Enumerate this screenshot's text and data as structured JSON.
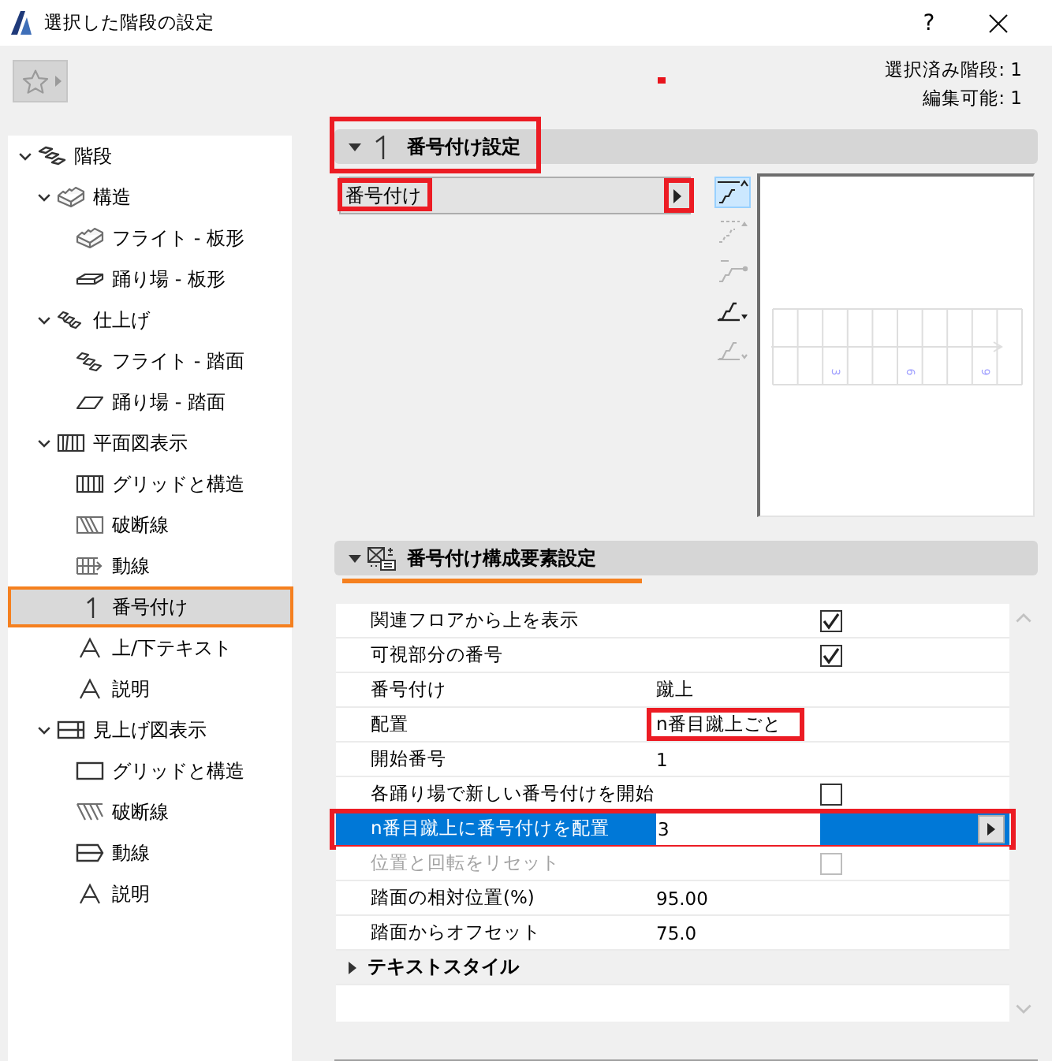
{
  "window": {
    "title": "選択した階段の設定",
    "help": "?"
  },
  "toolbar": {
    "selection_info": [
      "選択済み階段: 1",
      "編集可能: 1"
    ]
  },
  "tree": [
    {
      "label": "階段",
      "kind": "stair",
      "expanded": true,
      "selected": false,
      "children": [
        {
          "label": "構造",
          "kind": "structure",
          "expanded": true,
          "selected": false,
          "children": [
            {
              "label": "フライト - 板形",
              "kind": "flight-slab",
              "selected": false
            },
            {
              "label": "踊り場 - 板形",
              "kind": "landing-slab",
              "selected": false
            }
          ]
        },
        {
          "label": "仕上げ",
          "kind": "finish",
          "expanded": true,
          "selected": false,
          "children": [
            {
              "label": "フライト - 踏面",
              "kind": "flight-tread",
              "selected": false
            },
            {
              "label": "踊り場 - 踏面",
              "kind": "landing-tread",
              "selected": false
            }
          ]
        },
        {
          "label": "平面図表示",
          "kind": "plan",
          "expanded": true,
          "selected": false,
          "children": [
            {
              "label": "グリッドと構造",
              "kind": "grid",
              "selected": false
            },
            {
              "label": "破断線",
              "kind": "break-line",
              "selected": false
            },
            {
              "label": "動線",
              "kind": "walk-line",
              "selected": false
            },
            {
              "label": "番号付け",
              "kind": "numbering",
              "selected": true
            },
            {
              "label": "上/下テキスト",
              "kind": "text",
              "selected": false
            },
            {
              "label": "説明",
              "kind": "text",
              "selected": false
            }
          ]
        },
        {
          "label": "見上げ図表示",
          "kind": "ceiling",
          "expanded": true,
          "selected": false,
          "children": [
            {
              "label": "グリッドと構造",
              "kind": "outline",
              "selected": false
            },
            {
              "label": "破断線",
              "kind": "hatch",
              "selected": false
            },
            {
              "label": "動線",
              "kind": "box-arrow",
              "selected": false
            },
            {
              "label": "説明",
              "kind": "text",
              "selected": false
            }
          ]
        }
      ]
    }
  ],
  "numbering_settings": {
    "title": "番号付け設定",
    "expanded": true,
    "highlighted": true,
    "dropdown": {
      "label": "番号付け",
      "label_highlighted": true,
      "arrow_highlighted": true
    },
    "style_buttons": [
      {
        "kind": "top-line",
        "selected": true,
        "disabled": false
      },
      {
        "kind": "dashed",
        "selected": false,
        "disabled": true
      },
      {
        "kind": "dot-end",
        "selected": false,
        "disabled": true
      },
      {
        "kind": "bottom-menu",
        "selected": false,
        "disabled": false
      },
      {
        "kind": "bottom-chevron",
        "selected": false,
        "disabled": true
      }
    ],
    "preview": {
      "step_numbers": [
        "3",
        "6",
        "9"
      ]
    }
  },
  "component_settings": {
    "title": "番号付け構成要素設定",
    "expanded": true,
    "underlined": true,
    "rows": [
      {
        "kind": "checkbox",
        "label": "関連フロアから上を表示",
        "checked": true,
        "selected": false,
        "disabled": false,
        "highlighted": false,
        "value_highlighted": false
      },
      {
        "kind": "checkbox",
        "label": "可視部分の番号",
        "checked": true,
        "selected": false,
        "disabled": false,
        "highlighted": false,
        "value_highlighted": false
      },
      {
        "kind": "text",
        "label": "番号付け",
        "value": "蹴上",
        "selected": false,
        "disabled": false,
        "highlighted": false,
        "value_highlighted": false
      },
      {
        "kind": "text",
        "label": "配置",
        "value": "n番目蹴上ごと",
        "selected": false,
        "disabled": false,
        "highlighted": false,
        "value_highlighted": true
      },
      {
        "kind": "text",
        "label": "開始番号",
        "value": "1",
        "selected": false,
        "disabled": false,
        "highlighted": false,
        "value_highlighted": false
      },
      {
        "kind": "checkbox",
        "label": "各踊り場で新しい番号付けを開始",
        "checked": false,
        "selected": false,
        "disabled": false,
        "highlighted": false,
        "value_highlighted": false
      },
      {
        "kind": "text",
        "label": "n番目蹴上に番号付けを配置",
        "value": "3",
        "selected": true,
        "disabled": false,
        "highlighted": true,
        "value_highlighted": false
      },
      {
        "kind": "checkbox",
        "label": "位置と回転をリセット",
        "checked": false,
        "selected": false,
        "disabled": true,
        "highlighted": false,
        "value_highlighted": false
      },
      {
        "kind": "text",
        "label": "踏面の相対位置(%)",
        "value": "95.00",
        "selected": false,
        "disabled": false,
        "highlighted": false,
        "value_highlighted": false
      },
      {
        "kind": "text",
        "label": "踏面からオフセット",
        "value": "75.0",
        "selected": false,
        "disabled": false,
        "highlighted": false,
        "value_highlighted": false
      }
    ],
    "group": {
      "label": "テキストスタイル",
      "expanded": false
    }
  }
}
